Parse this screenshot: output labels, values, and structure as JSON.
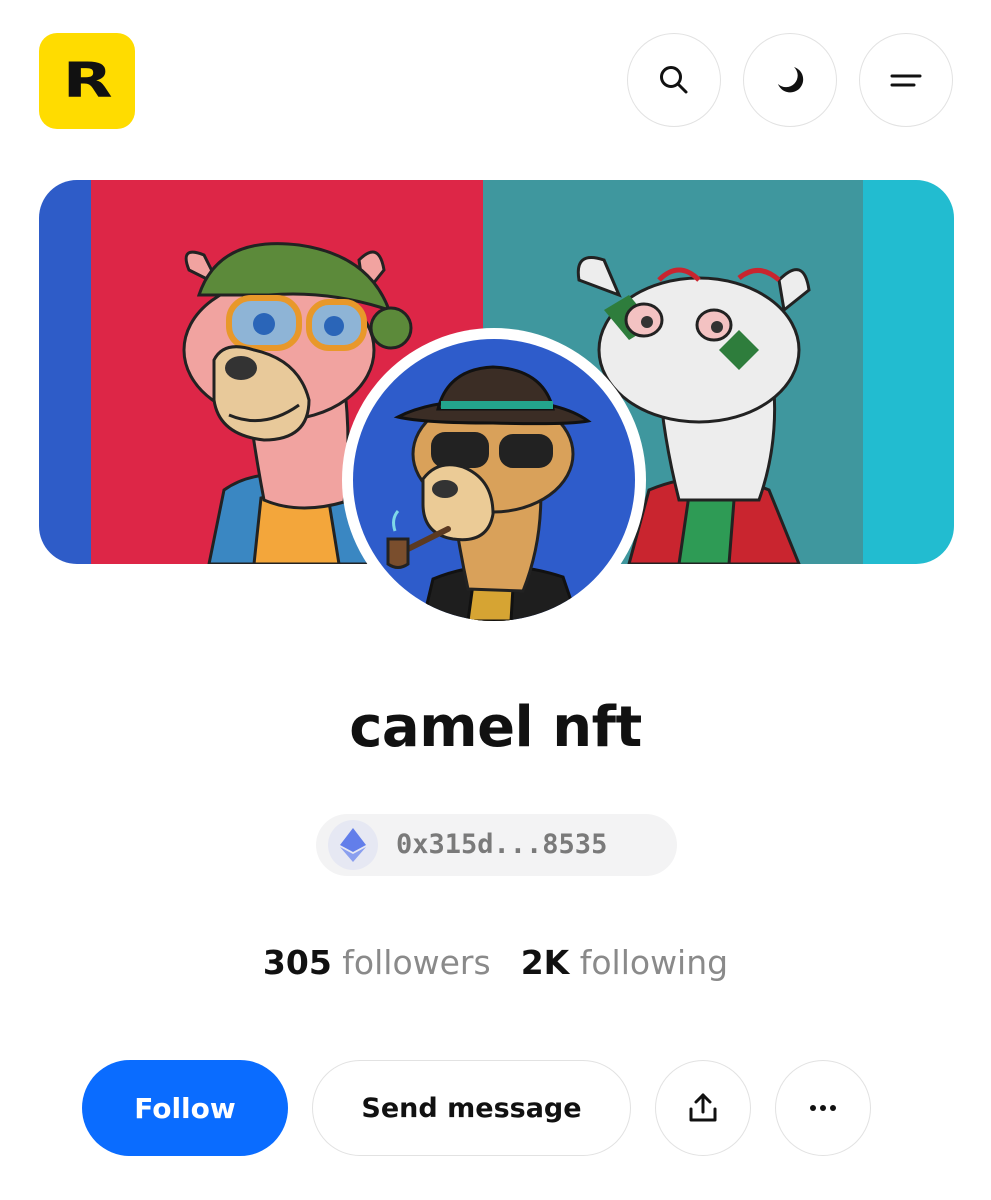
{
  "header": {
    "logo_letter": "R",
    "logo_color": "#FFDC00",
    "icons": [
      "search-icon",
      "moon-icon",
      "menu-icon"
    ]
  },
  "banner": {
    "panel_colors": [
      "#2E5CC8",
      "#DD2647",
      "#3F979E",
      "#22BCD0"
    ]
  },
  "profile": {
    "name": "camel nft",
    "address": "0x315d...8535",
    "chain_icon": "ethereum-icon",
    "avatar_bg": "#2E5CCB"
  },
  "stats": {
    "followers_count": "305",
    "followers_label": "followers",
    "following_count": "2K",
    "following_label": "following"
  },
  "actions": {
    "follow_label": "Follow",
    "message_label": "Send message",
    "share_icon": "share-icon",
    "more_icon": "more-icon",
    "accent": "#0A6CFF"
  }
}
